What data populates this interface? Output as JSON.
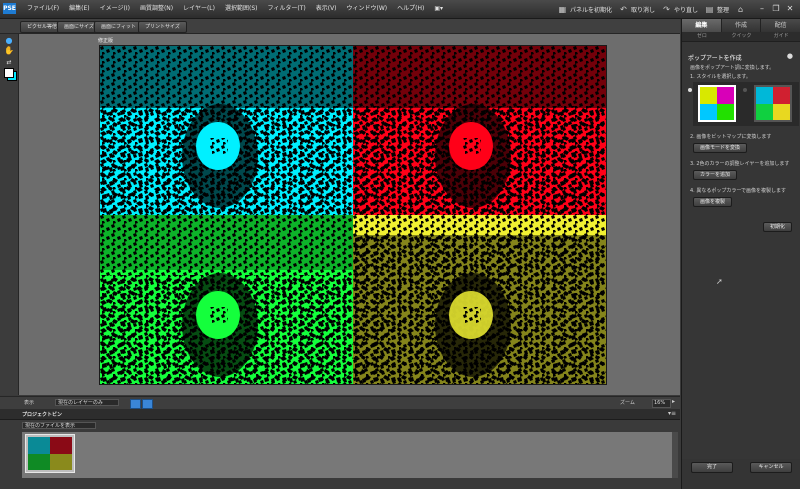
{
  "app": {
    "logo_text": "PSE"
  },
  "menu": [
    "ファイル(F)",
    "編集(E)",
    "イメージ(I)",
    "画質調整(N)",
    "レイヤー(L)",
    "選択範囲(S)",
    "フィルター(T)",
    "表示(V)",
    "ウィンドウ(W)",
    "ヘルプ(H)"
  ],
  "menu_right": {
    "reset_panels": "パネルを初期化",
    "undo": "取り消し",
    "redo": "やり直し",
    "organizer": "整理"
  },
  "options_bar": {
    "fit_screen": "ピクセル等倍",
    "actual_pixels": "画面にサイズ",
    "fill_screen": "画面にフィット",
    "print_size": "プリントサイズ"
  },
  "document": {
    "title": "修正版"
  },
  "status": {
    "label": "表示",
    "select_value": "現在のレイヤーのみ",
    "zoom_label": "ズーム",
    "zoom_value": "16%"
  },
  "project_bin": {
    "title": "プロジェクトビン",
    "select_value": "現在のファイルを表示",
    "collapse": "▾≡"
  },
  "panel": {
    "tabs": [
      "編集",
      "作成",
      "配信"
    ],
    "subtabs": [
      "ゼロ",
      "クイック",
      "ガイド"
    ],
    "title": "ポップアートを作成",
    "desc": "画像をポップアート調に変換します。",
    "step1": "1. スタイルを選択します。",
    "step2": "2. 画像をビットマップに変換します",
    "step2_btn": "画像モードを変換",
    "step3": "3. 2色のカラーの調整レイヤーを追加します",
    "step3_btn": "カラーを追加",
    "step4": "4. 異なるポップカラーで画像を複製します",
    "step4_btn": "画像を複製",
    "reset_btn": "初期化",
    "ok_btn": "完了",
    "cancel_btn": "キャンセル"
  },
  "colors": {
    "cyan": "#00f0ff",
    "red": "#ff0018",
    "green": "#14ff3c",
    "yellow": "#f0f032"
  }
}
